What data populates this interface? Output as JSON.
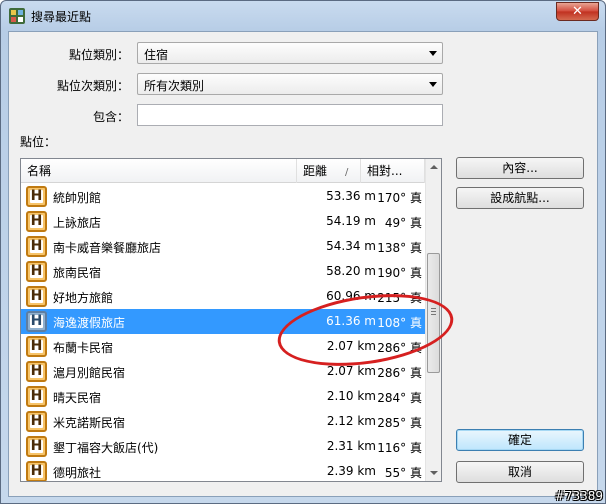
{
  "window": {
    "title": "搜尋最近點",
    "close_glyph": "✕"
  },
  "filters": {
    "category_label": "點位類別：",
    "category_value": "住宿",
    "subcategory_label": "點位次類別：",
    "subcategory_value": "所有次類別",
    "contains_label": "包含：",
    "contains_value": ""
  },
  "points_label": "點位：",
  "columns": {
    "name": "名稱",
    "distance": "距離",
    "distance_sort": "/",
    "bearing": "相對..."
  },
  "rows": [
    {
      "name": "統帥別館",
      "distance": "53.36 m",
      "bearing": "170° 真"
    },
    {
      "name": "上詠旅店",
      "distance": "54.19 m",
      "bearing": "49° 真"
    },
    {
      "name": "南卡威音樂餐廳旅店",
      "distance": "54.34 m",
      "bearing": "138° 真"
    },
    {
      "name": "旅南民宿",
      "distance": "58.20 m",
      "bearing": "190° 真"
    },
    {
      "name": "好地方旅館",
      "distance": "60.96 m",
      "bearing": "215° 真"
    },
    {
      "name": "海逸渡假旅店",
      "distance": "61.36 m",
      "bearing": "108° 真",
      "selected": true
    },
    {
      "name": "布蘭卡民宿",
      "distance": "2.07 km",
      "bearing": "286° 真"
    },
    {
      "name": "滬月別館民宿",
      "distance": "2.07 km",
      "bearing": "286° 真"
    },
    {
      "name": "晴天民宿",
      "distance": "2.10 km",
      "bearing": "284° 真"
    },
    {
      "name": "米克諾斯民宿",
      "distance": "2.12 km",
      "bearing": "285° 真"
    },
    {
      "name": "墾丁福容大飯店(代)",
      "distance": "2.31 km",
      "bearing": "116° 真"
    },
    {
      "name": "德明旅社",
      "distance": "2.39 km",
      "bearing": "55° 真"
    }
  ],
  "buttons": {
    "details": "內容...",
    "set_waypoint": "設成航點...",
    "ok": "確定",
    "cancel": "取消"
  },
  "watermark": "#73389"
}
